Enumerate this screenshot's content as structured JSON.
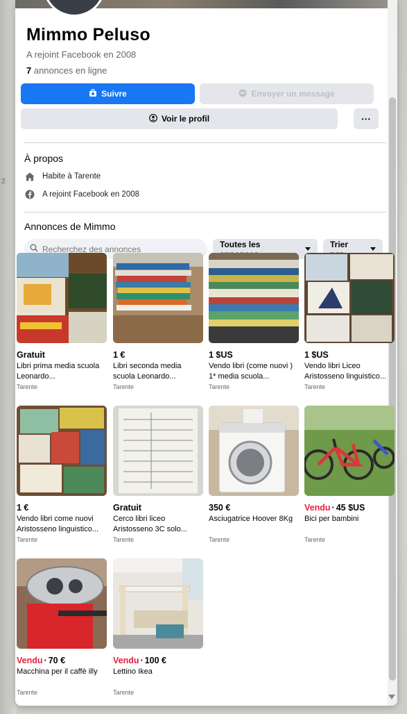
{
  "profile": {
    "name": "Mimmo Peluso",
    "joined": "A rejoint Facebook en 2008",
    "listings_count": "7",
    "listings_suffix": " annonces en ligne"
  },
  "actions": {
    "follow_label": "Suivre",
    "message_label": "Envoyer un message",
    "view_profile_label": "Voir le profil",
    "more_label": "···"
  },
  "about": {
    "title": "À propos",
    "lives_in": "Habite à Tarente",
    "joined": "A rejoint Facebook en 2008"
  },
  "listings": {
    "title": "Annonces de Mimmo",
    "search_placeholder": "Recherchez des annonces",
    "filter_label": "Toutes les annonces",
    "sort_label": "Trier par",
    "items": [
      {
        "sold": "",
        "price": "Gratuit",
        "title": "Libri prima media scuola Leonardo...",
        "location": "Tarente"
      },
      {
        "sold": "",
        "price": "1 €",
        "title": "Libri seconda media scuola Leonardo...",
        "location": "Tarente"
      },
      {
        "sold": "",
        "price": "1 $US",
        "title": "Vendo libri (come nuovi ) 1* media scuola...",
        "location": "Tarente"
      },
      {
        "sold": "",
        "price": "1 $US",
        "title": "Vendo libri Liceo Aristosseno linguistico...",
        "location": "Tarente"
      },
      {
        "sold": "",
        "price": "1 €",
        "title": "Vendo libri come nuovi Aristosseno linguistico...",
        "location": "Tarente"
      },
      {
        "sold": "",
        "price": "Gratuit",
        "title": "Cerco libri liceo Aristosseno 3C solo...",
        "location": "Tarente"
      },
      {
        "sold": "",
        "price": "350 €",
        "title": "Asciugatrice Hoover 8Kg",
        "location": "Tarente"
      },
      {
        "sold": "Vendu",
        "price": "45 $US",
        "title": "Bici per bambini",
        "location": "Tarente"
      },
      {
        "sold": "Vendu",
        "price": "70 €",
        "title": "Macchina per il caffè illy",
        "location": "Tarente"
      },
      {
        "sold": "Vendu",
        "price": "100 €",
        "title": "Lettino Ikea",
        "location": "Tarente"
      }
    ]
  },
  "colors": {
    "accent": "#1877f2",
    "sold": "#e41e3f",
    "button_bg": "#e4e6eb"
  },
  "edge_fragment": "2"
}
